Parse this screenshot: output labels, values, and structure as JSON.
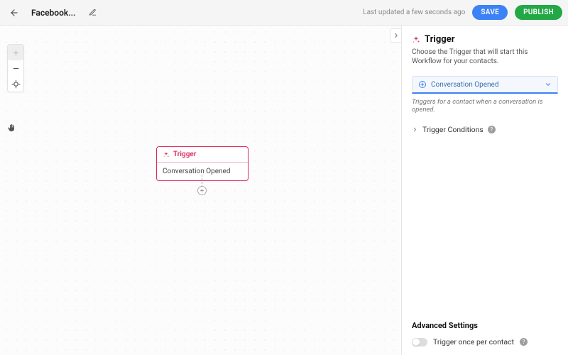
{
  "header": {
    "title": "Facebook...",
    "last_updated": "Last updated a few seconds ago",
    "save_label": "SAVE",
    "publish_label": "PUBLISH"
  },
  "canvas": {
    "node": {
      "title": "Trigger",
      "subtitle": "Conversation Opened"
    }
  },
  "panel": {
    "title": "Trigger",
    "description": "Choose the Trigger that will start this Workflow for your contacts.",
    "select": {
      "value": "Conversation Opened",
      "icon": "plus-circle-icon"
    },
    "select_hint": "Triggers for a contact when a conversation is opened.",
    "conditions_label": "Trigger Conditions",
    "advanced_title": "Advanced Settings",
    "toggle_label": "Trigger once per contact"
  },
  "colors": {
    "accent_blue": "#3b82f6",
    "accent_green": "#22a845",
    "trigger_pink": "#de2b5c"
  }
}
